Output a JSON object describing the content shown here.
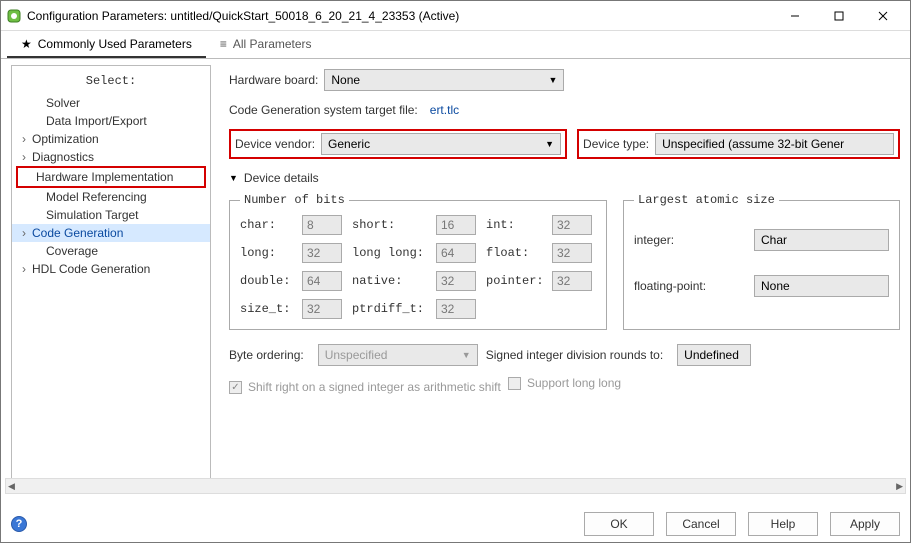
{
  "window": {
    "title": "Configuration Parameters: untitled/QuickStart_50018_6_20_21_4_23353 (Active)"
  },
  "tabs": {
    "common": "Commonly Used Parameters",
    "all": "All Parameters"
  },
  "sidebar": {
    "title": "Select:",
    "items": {
      "solver": "Solver",
      "dataio": "Data Import/Export",
      "opt": "Optimization",
      "diag": "Diagnostics",
      "hw": "Hardware Implementation",
      "modelref": "Model Referencing",
      "simtarget": "Simulation Target",
      "codegen": "Code Generation",
      "coverage": "Coverage",
      "hdl": "HDL Code Generation"
    }
  },
  "fields": {
    "hw_board_label": "Hardware board:",
    "hw_board_value": "None",
    "cg_target_label": "Code Generation system target file:",
    "cg_target_value": "ert.tlc",
    "vendor_label": "Device vendor:",
    "vendor_value": "Generic",
    "devtype_label": "Device type:",
    "devtype_value": "Unspecified (assume 32-bit Gener",
    "details_header": "Device details"
  },
  "bits": {
    "legend": "Number of bits",
    "char_l": "char:",
    "char_v": "8",
    "short_l": "short:",
    "short_v": "16",
    "int_l": "int:",
    "int_v": "32",
    "long_l": "long:",
    "long_v": "32",
    "longlong_l": "long long:",
    "longlong_v": "64",
    "float_l": "float:",
    "float_v": "32",
    "double_l": "double:",
    "double_v": "64",
    "native_l": "native:",
    "native_v": "32",
    "pointer_l": "pointer:",
    "pointer_v": "32",
    "sizet_l": "size_t:",
    "sizet_v": "32",
    "ptrdiff_l": "ptrdiff_t:",
    "ptrdiff_v": "32"
  },
  "atomic": {
    "legend": "Largest atomic size",
    "int_l": "integer:",
    "int_v": "Char",
    "fp_l": "floating-point:",
    "fp_v": "None"
  },
  "lower": {
    "byteorder_l": "Byte ordering:",
    "byteorder_v": "Unspecified",
    "rounds_l": "Signed integer division rounds to:",
    "rounds_v": "Undefined",
    "shift_l": "Shift right on a signed integer as arithmetic shift",
    "supportll_l": "Support long long"
  },
  "buttons": {
    "ok": "OK",
    "cancel": "Cancel",
    "help": "Help",
    "apply": "Apply"
  }
}
